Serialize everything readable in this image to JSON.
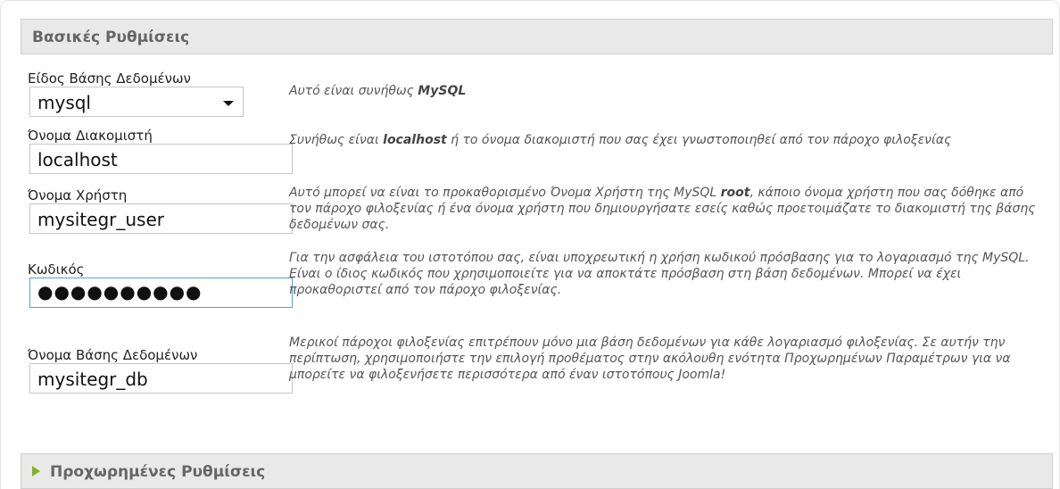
{
  "section": {
    "title": "Βασικές Ρυθμίσεις"
  },
  "fields": {
    "db_type": {
      "label": "Είδος Βάσης Δεδομένων",
      "value": "mysql",
      "desc_pre": "Αυτό είναι συνήθως ",
      "desc_bold": "MySQL",
      "desc_post": ""
    },
    "host": {
      "label": "Όνομα Διακομιστή",
      "value": "localhost",
      "desc_pre": "Συνήθως είναι ",
      "desc_bold": "localhost",
      "desc_post": " ή το όνομα διακομιστή που σας έχει γνωστοποιηθεί από τον πάροχο φιλοξενίας"
    },
    "username": {
      "label": "Όνομα Χρήστη",
      "value": "mysitegr_user",
      "desc_pre": "Αυτό μπορεί να είναι το προκαθορισμένο Όνομα Χρήστη της MySQL ",
      "desc_bold": "root",
      "desc_post": ", κάποιο όνομα χρήστη που σας δόθηκε από τον πάροχο φιλοξενίας ή ένα όνομα χρήστη που δημιουργήσατε εσείς καθώς προετοιμάζατε το διακομιστή της βάσης δεδομένων σας."
    },
    "password": {
      "label": "Κωδικός",
      "value_masked": "●●●●●●●●●●",
      "desc": "Για την ασφάλεια του ιστοτόπου σας, είναι υποχρεωτική η χρήση κωδικού πρόσβασης για το λογαριασμό της MySQL. Είναι ο ίδιος κωδικός που χρησιμοποιείτε για να αποκτάτε πρόσβαση στη βάση δεδομένων. Μπορεί να έχει προκαθοριστεί από τον πάροχο φιλοξενίας."
    },
    "db_name": {
      "label": "Όνομα Βάσης Δεδομένων",
      "value": "mysitegr_db",
      "desc": "Μερικοί πάροχοι φιλοξενίας επιτρέπουν μόνο μια βάση δεδομένων για κάθε λογαριασμό φιλοξενίας. Σε αυτήν την περίπτωση, χρησιμοποιήστε την επιλογή προθέματος στην ακόλουθη ενότητα Προχωρημένων Παραμέτρων για να μπορείτε να φιλοξενήσετε περισσότερα από έναν ιστοτόπους Joomla!"
    }
  },
  "advanced": {
    "title": "Προχωρημένες Ρυθμίσεις"
  },
  "colors": {
    "header_bg": "#e9e9e9",
    "arrow": "#7bb52a",
    "focus_border": "#5b9bd5"
  }
}
